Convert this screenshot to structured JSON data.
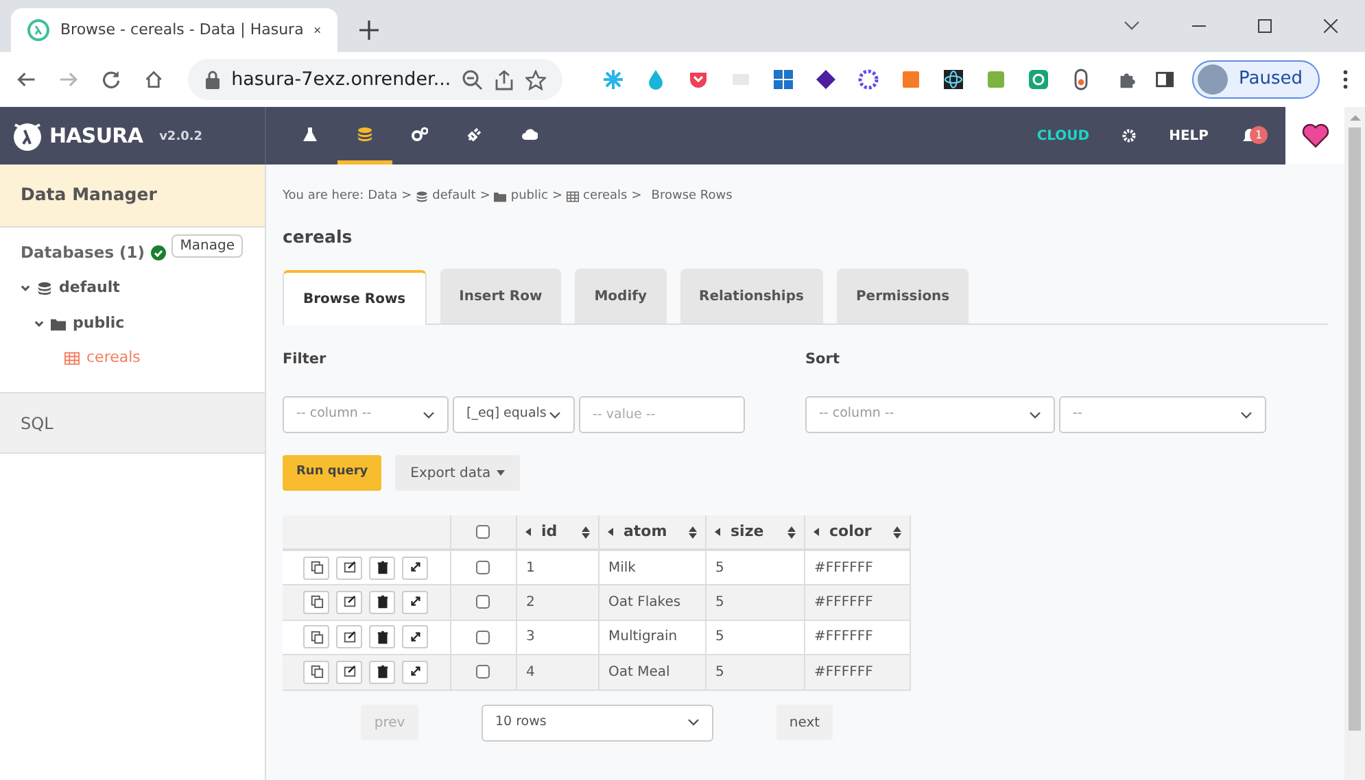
{
  "browser": {
    "tab_title": "Browse - cereals - Data | Hasura",
    "url": "hasura-7exz.onrender...",
    "profile_label": "Paused"
  },
  "app_header": {
    "brand": "HASURA",
    "version": "v2.0.2",
    "nav": [
      {
        "kind": "flask",
        "selected": false
      },
      {
        "kind": "database",
        "selected": true
      },
      {
        "kind": "gears",
        "selected": false
      },
      {
        "kind": "plug",
        "selected": false
      },
      {
        "kind": "cloud",
        "selected": false
      }
    ],
    "cloud": "CLOUD",
    "help": "HELP",
    "notification_count": "1"
  },
  "sidebar": {
    "title": "Data Manager",
    "databases_label": "Databases (1)",
    "manage": "Manage",
    "tree": [
      {
        "label": "default",
        "kind": "database",
        "expanded": true,
        "children": [
          {
            "label": "public",
            "kind": "schema",
            "expanded": true,
            "children": [
              {
                "label": "cereals",
                "kind": "table",
                "selected": true
              }
            ]
          }
        ]
      }
    ],
    "sql": "SQL"
  },
  "breadcrumb": {
    "prefix": "You are here:",
    "separator": ">",
    "items": [
      {
        "label": "Data",
        "kind": "text"
      },
      {
        "label": "default",
        "kind": "database"
      },
      {
        "label": "public",
        "kind": "schema"
      },
      {
        "label": "cereals",
        "kind": "table"
      },
      {
        "label": "Browse Rows",
        "kind": "text"
      }
    ]
  },
  "title": "cereals",
  "tabs": [
    {
      "label": "Browse Rows",
      "selected": true
    },
    {
      "label": "Insert Row",
      "selected": false
    },
    {
      "label": "Modify",
      "selected": false
    },
    {
      "label": "Relationships",
      "selected": false
    },
    {
      "label": "Permissions",
      "selected": false
    }
  ],
  "filter": {
    "label": "Filter",
    "column_placeholder": "-- column --",
    "operator": "[_eq] equals",
    "value_placeholder": "-- value --"
  },
  "sort": {
    "label": "Sort",
    "column_placeholder": "-- column --",
    "order": "--"
  },
  "run_query": "Run query",
  "export": "Export data",
  "table": {
    "select_all_checked": false,
    "columns": [
      "id",
      "atom",
      "size",
      "color"
    ],
    "rows": [
      {
        "cells": [
          "1",
          "Milk",
          "5",
          "#FFFFFF"
        ],
        "checked": false
      },
      {
        "cells": [
          "2",
          "Oat Flakes",
          "5",
          "#FFFFFF"
        ],
        "checked": false
      },
      {
        "cells": [
          "3",
          "Multigrain",
          "5",
          "#FFFFFF"
        ],
        "checked": false
      },
      {
        "cells": [
          "4",
          "Oat Meal",
          "5",
          "#FFFFFF"
        ],
        "checked": false
      }
    ]
  },
  "pagination": {
    "prev": "prev",
    "page_size": "10 rows",
    "next": "next"
  }
}
